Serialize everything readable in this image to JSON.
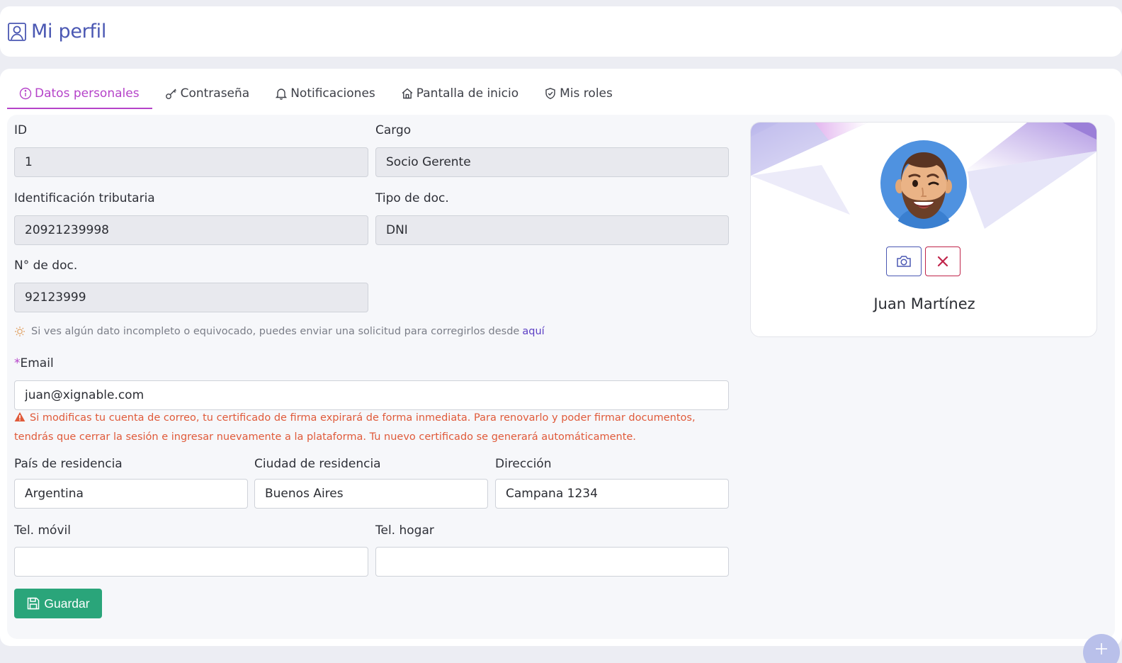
{
  "header": {
    "title": "Mi perfil",
    "icon": "user-square-icon"
  },
  "tabs": [
    {
      "label": "Datos personales",
      "icon": "info-circle-icon",
      "active": true
    },
    {
      "label": "Contraseña",
      "icon": "key-icon",
      "active": false
    },
    {
      "label": "Notificaciones",
      "icon": "bell-icon",
      "active": false
    },
    {
      "label": "Pantalla de inicio",
      "icon": "home-icon",
      "active": false
    },
    {
      "label": "Mis roles",
      "icon": "shield-check-icon",
      "active": false
    }
  ],
  "form": {
    "id": {
      "label": "ID",
      "value": "1"
    },
    "cargo": {
      "label": "Cargo",
      "value": "Socio Gerente"
    },
    "tax_id": {
      "label": "Identificación tributaria",
      "value": "20921239998"
    },
    "doc_type": {
      "label": "Tipo de doc.",
      "value": "DNI"
    },
    "doc_number": {
      "label": "N° de doc.",
      "value": "92123999"
    },
    "hint": {
      "text": "Si ves algún dato incompleto o equivocado, puedes enviar una solicitud para corregirlos desde",
      "link": "aquí"
    },
    "email": {
      "required_mark": "*",
      "label": "Email",
      "value": "juan@xignable.com"
    },
    "email_warning": "Si modificas tu cuenta de correo, tu certificado de firma expirará de forma inmediata. Para renovarlo y poder firmar documentos, tendrás que cerrar la sesión e ingresar nuevamente a la plataforma. Tu nuevo certificado se generará automáticamente.",
    "country": {
      "label": "País de residencia",
      "value": "Argentina"
    },
    "city": {
      "label": "Ciudad de residencia",
      "value": "Buenos Aires"
    },
    "address": {
      "label": "Dirección",
      "value": "Campana 1234"
    },
    "mobile": {
      "label": "Tel. móvil",
      "value": ""
    },
    "home_phone": {
      "label": "Tel. hogar",
      "value": ""
    },
    "save_label": "Guardar"
  },
  "profile": {
    "name": "Juan Martínez"
  },
  "colors": {
    "accent": "#b543c9",
    "primary": "#4b58b3",
    "success": "#2aa57a",
    "danger": "#c0244a",
    "warning": "#e05a3a"
  }
}
